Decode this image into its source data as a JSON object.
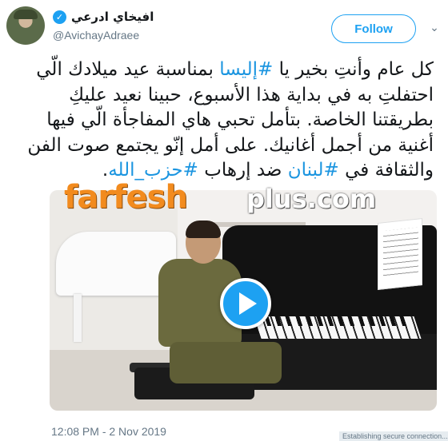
{
  "user": {
    "display_name": "افيخاي ادرعي",
    "handle": "@AvichayAdraee",
    "verified_icon": "verified-badge-icon"
  },
  "actions": {
    "follow_label": "Follow",
    "more_icon": "chevron-down-icon"
  },
  "tweet": {
    "text_before_1": "كل عام وأنتِ بخير يا ",
    "hashtag_1": "#إليسا",
    "text_before_2": " بمناسبة عيد ميلادك الّي احتفلتِ به في بداية هذا الأسبوع، حبينا نعيد عليكِ بطريقتنا الخاصة. بتأمل تحبي هاي المفاجأة الّي فيها أغنية من أجمل أغانيك. على أمل إنّو يجتمع صوت الفن والثقافة في ",
    "hashtag_2": "#لبنان",
    "text_before_3": " ضد إرهاب ",
    "hashtag_3": "#حزب_الله",
    "text_end": "."
  },
  "media": {
    "play_icon": "play-icon"
  },
  "watermark": {
    "part1": "farfesh",
    "part2": "plus.com"
  },
  "meta": {
    "timestamp": "12:08 PM - 2 Nov 2019",
    "status_text": "Establishing secure connection..."
  },
  "colors": {
    "accent": "#1da1f2",
    "hashtag": "#1b95e0",
    "muted": "#657786"
  }
}
